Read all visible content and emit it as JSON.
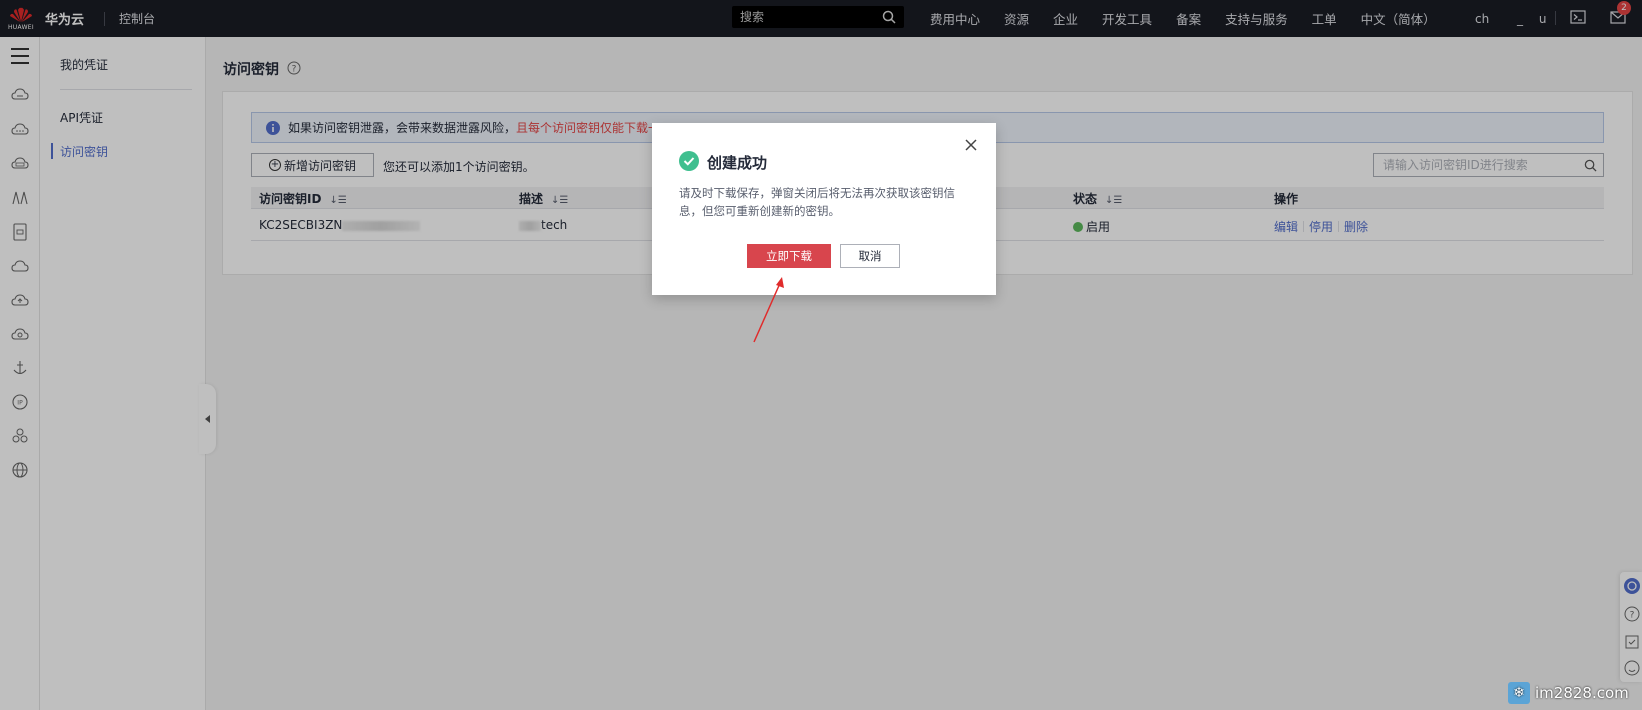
{
  "topbar": {
    "logo_text": "HUAWEI",
    "brand": "华为云",
    "console": "控制台",
    "search_placeholder": "搜索",
    "nav": [
      "费用中心",
      "资源",
      "企业",
      "开发工具",
      "备案",
      "支持与服务",
      "工单",
      "中文（简体）"
    ],
    "user": "ch　 　_ 　u",
    "badge_count": "2"
  },
  "submenu": {
    "title": "我的凭证",
    "items": [
      "API凭证",
      "访问密钥"
    ],
    "active_index": 1
  },
  "main": {
    "page_title": "访问密钥",
    "alert_normal": "如果访问密钥泄露，会带来数据泄露风险，",
    "alert_red": "且每个访问密钥仅能下载一",
    "add_button": "新增访问密钥",
    "hint": "您还可以添加1个访问密钥。",
    "search_placeholder": "请输入访问密钥ID进行搜索",
    "table": {
      "columns": [
        "访问密钥ID",
        "描述",
        "状态",
        "操作"
      ],
      "rows": [
        {
          "id": "KC2SECBI3ZN",
          "desc": "tech",
          "status": "启用",
          "ops": [
            "编辑",
            "停用",
            "删除"
          ]
        }
      ]
    }
  },
  "dialog": {
    "title": "创建成功",
    "message": "请及时下载保存，弹窗关闭后将无法再次获取该密钥信息，但您可重新创建新的密钥。",
    "primary": "立即下载",
    "cancel": "取消"
  },
  "watermark": "im2828.com",
  "colors": {
    "accent": "#526ecc",
    "danger": "#d8454d",
    "success": "#3fbf8f",
    "topbar": "#1a1c24"
  }
}
